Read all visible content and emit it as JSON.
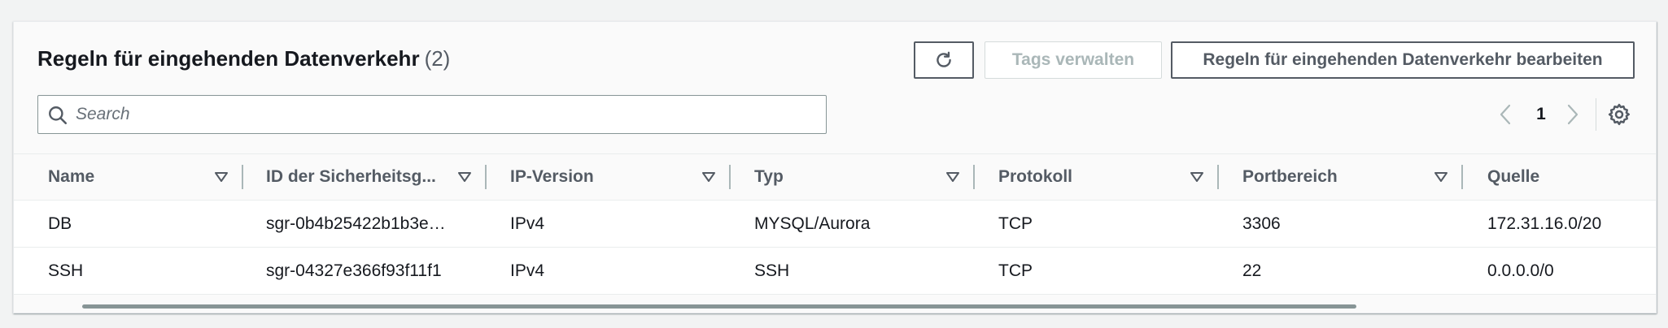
{
  "header": {
    "title": "Regeln für eingehenden Datenverkehr",
    "count": "(2)"
  },
  "actions": {
    "refresh_icon": "refresh-icon",
    "manage_tags_label": "Tags verwalten",
    "edit_label": "Regeln für eingehenden Datenverkehr bearbeiten"
  },
  "search": {
    "placeholder": "Search",
    "value": ""
  },
  "pagination": {
    "current_page": "1"
  },
  "table": {
    "columns": [
      "Name",
      "ID der Sicherheitsg...",
      "IP-Version",
      "Typ",
      "Protokoll",
      "Portbereich",
      "Quelle"
    ],
    "rows": [
      [
        "DB",
        "sgr-0b4b25422b1b3e…",
        "IPv4",
        "MYSQL/Aurora",
        "TCP",
        "3306",
        "172.31.16.0/20"
      ],
      [
        "SSH",
        "sgr-04327e366f93f11f1",
        "IPv4",
        "SSH",
        "TCP",
        "22",
        "0.0.0.0/0"
      ]
    ]
  },
  "colors": {
    "accent": "#545b64",
    "disabled": "#aab7b8",
    "text": "#16191f"
  }
}
